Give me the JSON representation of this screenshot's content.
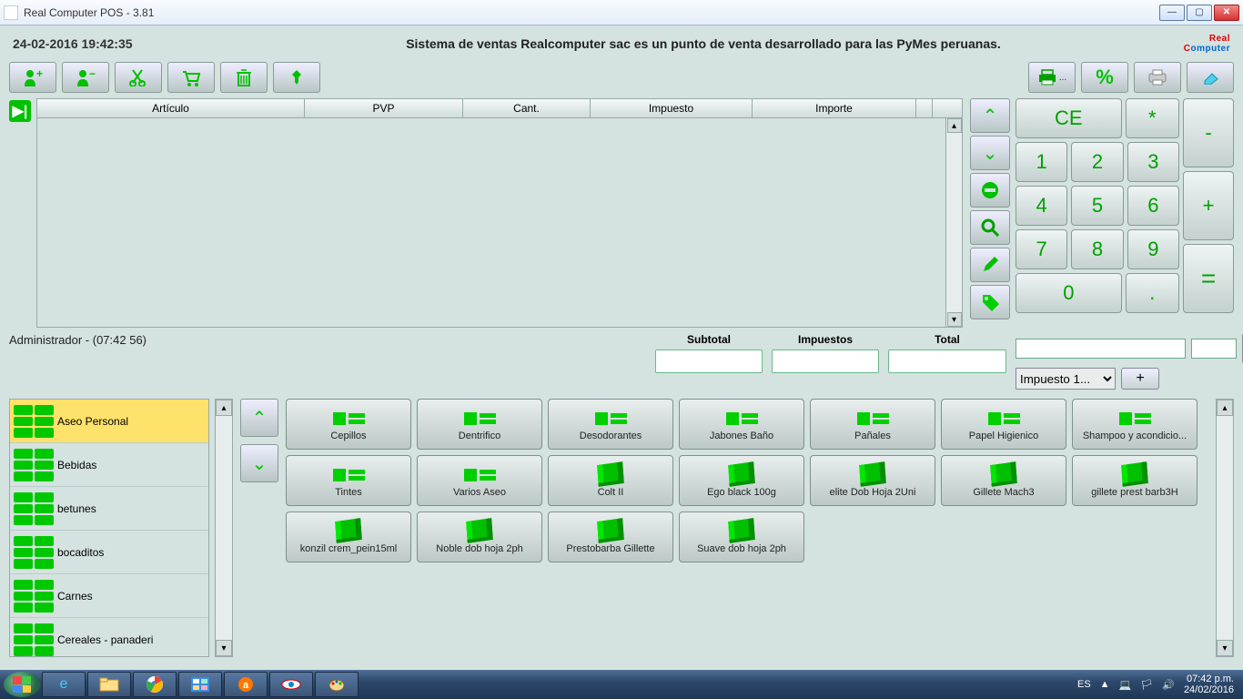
{
  "window": {
    "title": "Real Computer POS - 3.81"
  },
  "header": {
    "datetime": "24-02-2016 19:42:35",
    "tagline": "Sistema de ventas Realcomputer sac es un punto de venta desarrollado para las PyMes peruanas.",
    "logo_top": "Real",
    "logo_bottom": "omputer",
    "logo_bottom_accent": "C"
  },
  "grid": {
    "col_articulo": "Artículo",
    "col_pvp": "PVP",
    "col_cant": "Cant.",
    "col_impuesto": "Impuesto",
    "col_importe": "Importe"
  },
  "status": {
    "admin": "Administrador - (07:42 56)"
  },
  "totals": {
    "subtotal_label": "Subtotal",
    "impuestos_label": "Impuestos",
    "total_label": "Total",
    "subtotal": "",
    "impuestos": "",
    "total": ""
  },
  "tax": {
    "select_label": "Impuesto 1...",
    "plus": "+"
  },
  "numpad": {
    "ce": "CE",
    "star": "*",
    "minus": "-",
    "plus": "+",
    "equals": "=",
    "dot": ".",
    "d1": "1",
    "d2": "2",
    "d3": "3",
    "d4": "4",
    "d5": "5",
    "d6": "6",
    "d7": "7",
    "d8": "8",
    "d9": "9",
    "d0": "0"
  },
  "categories": [
    {
      "label": "Aseo Personal",
      "selected": true
    },
    {
      "label": "Bebidas",
      "selected": false
    },
    {
      "label": "betunes",
      "selected": false
    },
    {
      "label": "bocaditos",
      "selected": false
    },
    {
      "label": "Carnes",
      "selected": false
    },
    {
      "label": "Cereales - panaderi",
      "selected": false
    }
  ],
  "products": {
    "folder_row": [
      {
        "label": "Cepillos"
      },
      {
        "label": "Dentrifico"
      },
      {
        "label": "Desodorantes"
      },
      {
        "label": "Jabones Baño"
      },
      {
        "label": "Pañales"
      },
      {
        "label": "Papel Higienico"
      },
      {
        "label": "Shampoo y acondicio..."
      }
    ],
    "item_rows": [
      {
        "label": "Tintes"
      },
      {
        "label": "Varios Aseo"
      },
      {
        "label": "Colt II"
      },
      {
        "label": "Ego black 100g"
      },
      {
        "label": "elite Dob Hoja 2Uni"
      },
      {
        "label": "Gillete Mach3"
      },
      {
        "label": "gillete prest barb3H"
      },
      {
        "label": "konzil crem_pein15ml"
      },
      {
        "label": "Noble dob hoja 2ph"
      },
      {
        "label": "Prestobarba Gillette"
      },
      {
        "label": "Suave dob hoja 2ph"
      }
    ]
  },
  "taskbar": {
    "lang": "ES",
    "time": "07:42 p.m.",
    "date": "24/02/2016"
  }
}
